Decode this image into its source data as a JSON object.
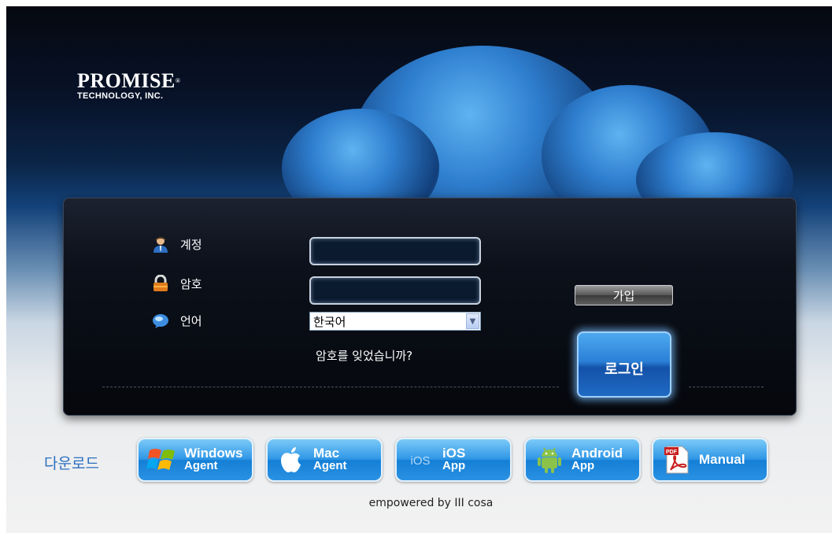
{
  "brand": {
    "name": "PROMISE",
    "registered": "®",
    "subtitle": "TECHNOLOGY, INC."
  },
  "login": {
    "account_label": "계정",
    "password_label": "암호",
    "language_label": "언어",
    "account_value": "",
    "password_value": "",
    "language_selected": "한국어",
    "forgot_link": "암호를 잊었습니까?",
    "join_button": "가입",
    "login_button": "로그인"
  },
  "downloads": {
    "label": "다운로드",
    "items": [
      {
        "icon": "windows-icon",
        "line1": "Windows",
        "line2": "Agent"
      },
      {
        "icon": "apple-icon",
        "line1": "Mac",
        "line2": "Agent"
      },
      {
        "icon": "ios-icon",
        "line1": "iOS",
        "line2": "App",
        "icon_text": "iOS"
      },
      {
        "icon": "android-icon",
        "line1": "Android",
        "line2": "App"
      },
      {
        "icon": "pdf-icon",
        "line1": "Manual",
        "line2": "",
        "icon_text": "PDF"
      }
    ]
  },
  "footer": "empowered by III cosa",
  "colors": {
    "accent": "#2b80d7",
    "download_label": "#2c6fc0"
  }
}
